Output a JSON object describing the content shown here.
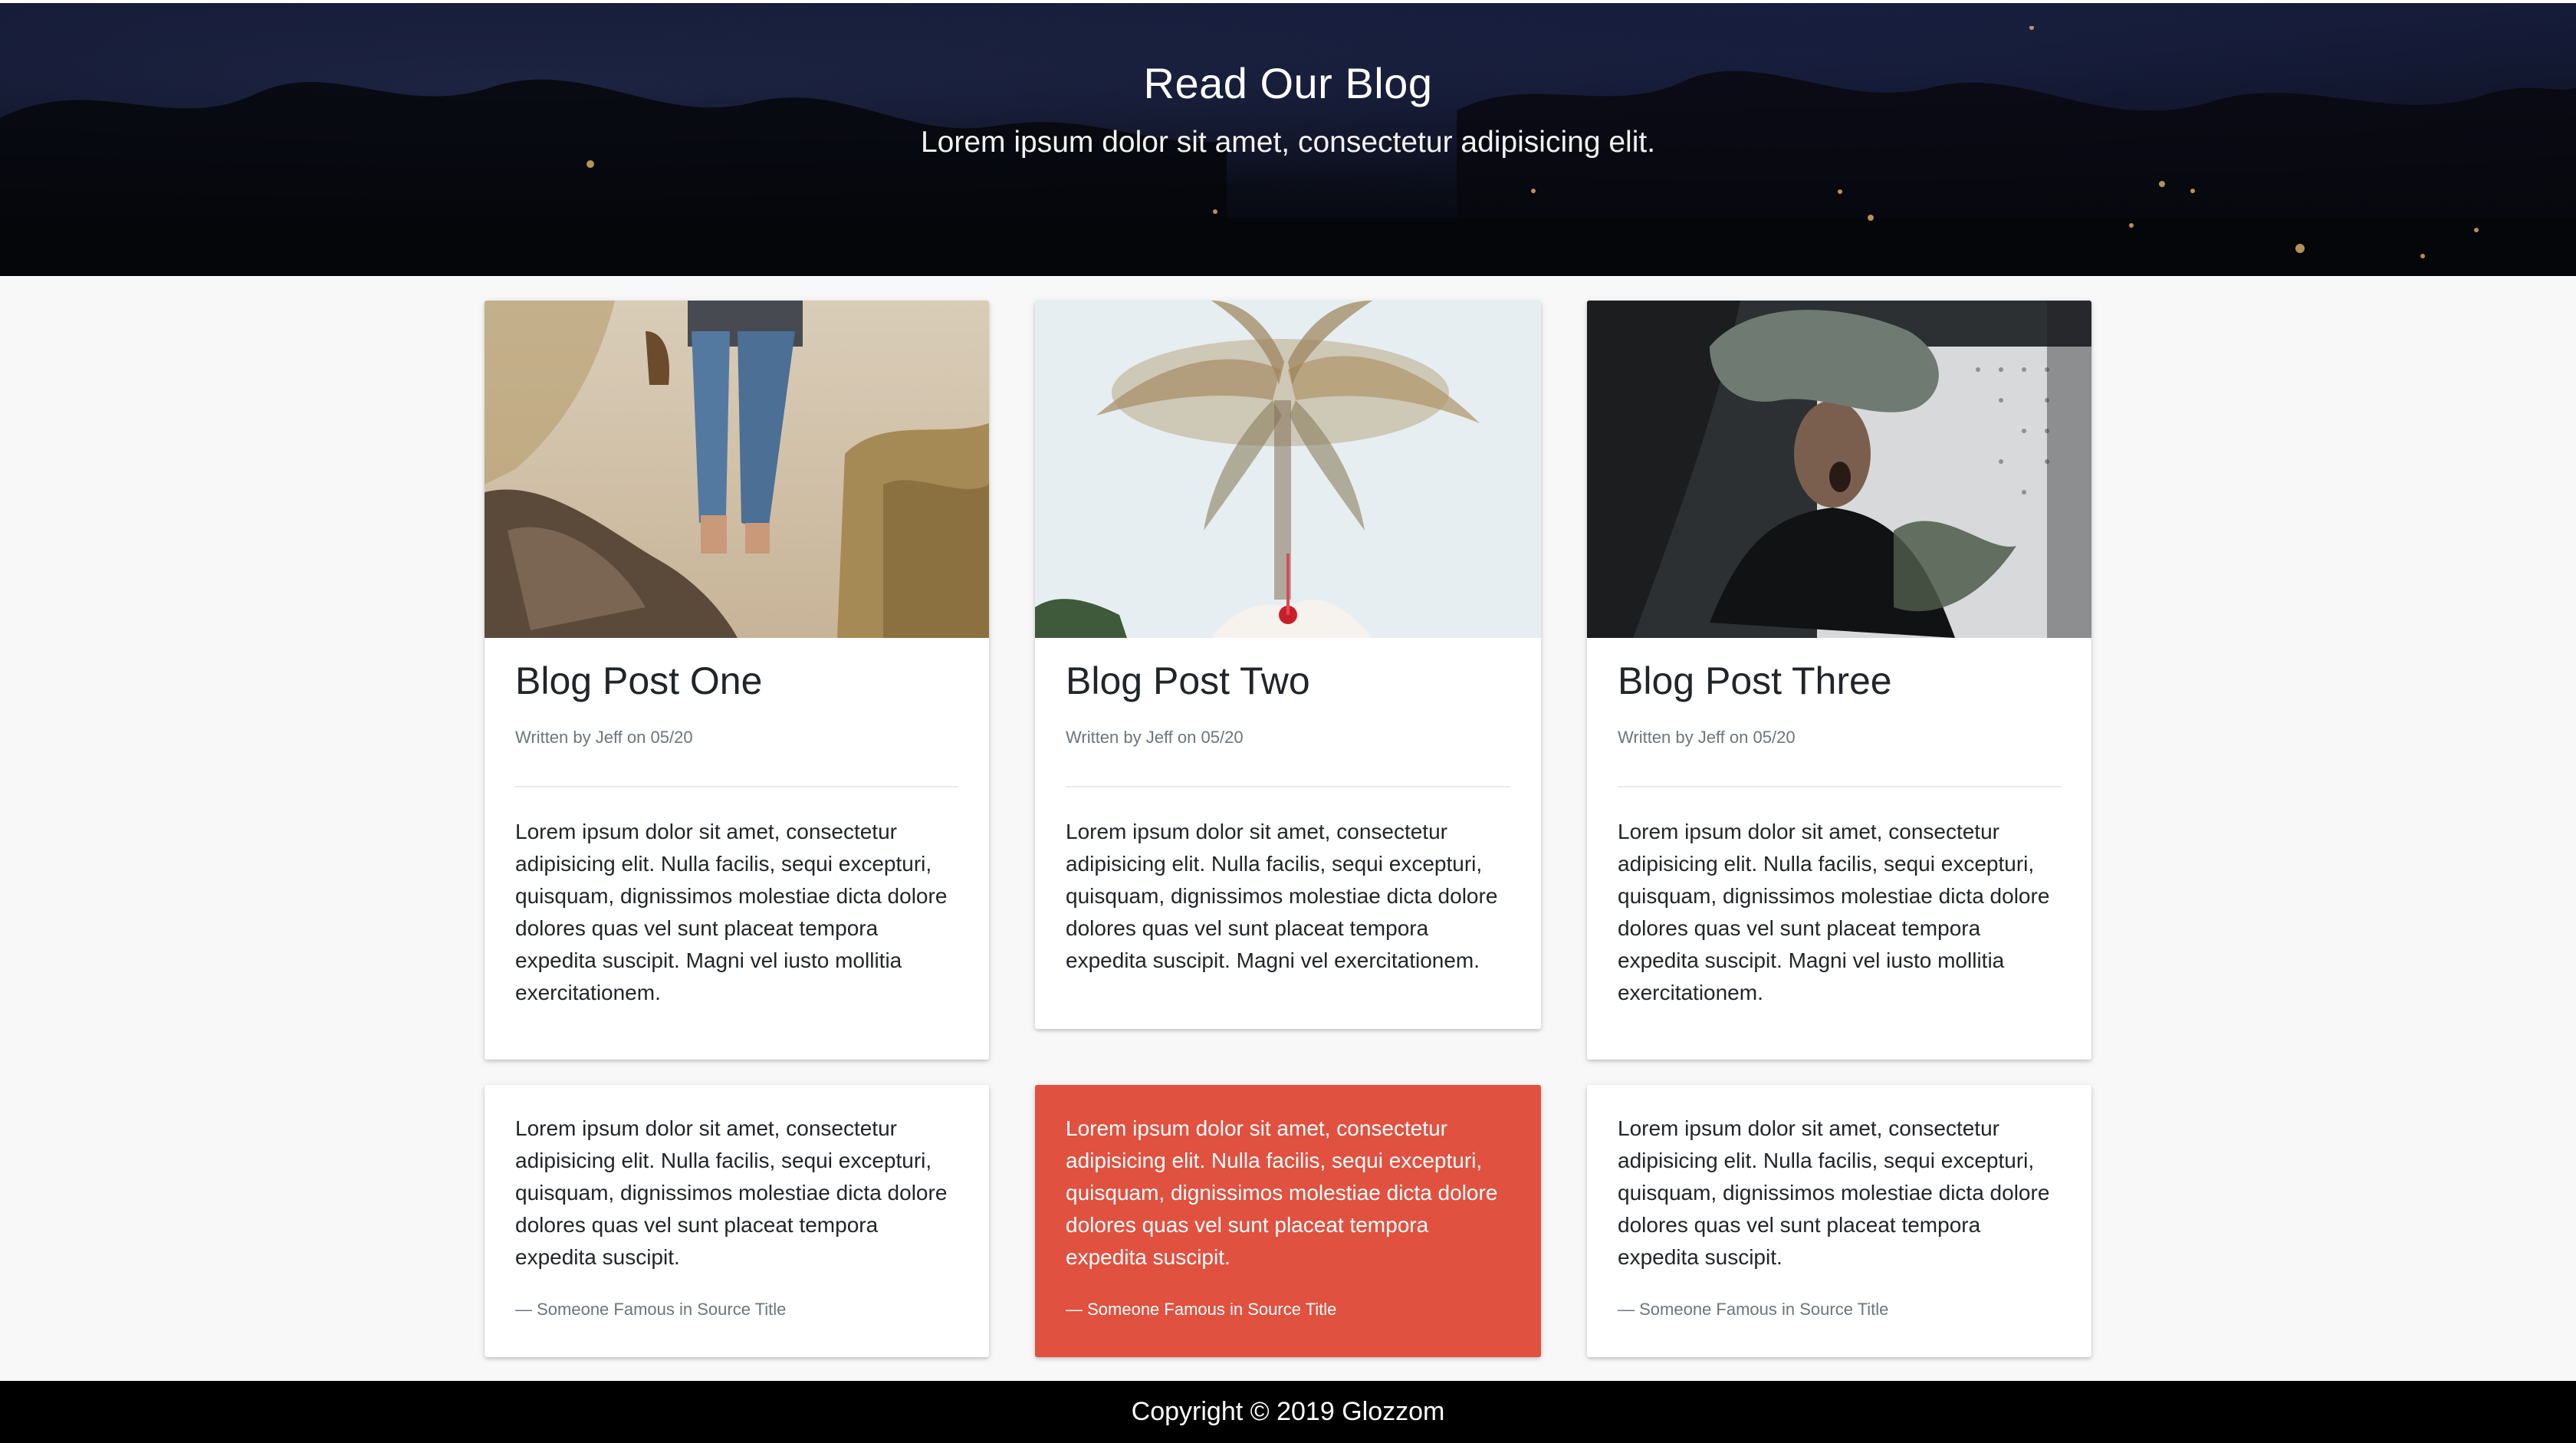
{
  "hero": {
    "title": "Read Our Blog",
    "subtitle": "Lorem ipsum dolor sit amet, consectetur adipisicing elit."
  },
  "posts": [
    {
      "image": "beach-walker-photo",
      "title": "Blog Post One",
      "meta": "Written by Jeff on 05/20",
      "body": "Lorem ipsum dolor sit amet, consectetur adipisicing elit. Nulla facilis, sequi excepturi, quisquam, dignissimos molestiae dicta dolore dolores quas vel sunt placeat tempora expedita suscipit. Magni vel iusto mollitia exercitationem."
    },
    {
      "image": "palm-tree-photo",
      "title": "Blog Post Two",
      "meta": "Written by Jeff on 05/20",
      "body": "Lorem ipsum dolor sit amet, consectetur adipisicing elit. Nulla facilis, sequi excepturi, quisquam, dignissimos molestiae dicta dolore dolores quas vel sunt placeat tempora expedita suscipit. Magni vel exercitationem."
    },
    {
      "image": "masked-person-photo",
      "title": "Blog Post Three",
      "meta": "Written by Jeff on 05/20",
      "body": "Lorem ipsum dolor sit amet, consectetur adipisicing elit. Nulla facilis, sequi excepturi, quisquam, dignissimos molestiae dicta dolore dolores quas vel sunt placeat tempora expedita suscipit. Magni vel iusto mollitia exercitationem."
    }
  ],
  "quotes": [
    {
      "text": "Lorem ipsum dolor sit amet, consectetur adipisicing elit. Nulla facilis, sequi excepturi, quisquam, dignissimos molestiae dicta dolore dolores quas vel sunt placeat tempora expedita suscipit.",
      "source": "— Someone Famous in Source Title"
    },
    {
      "text": "Lorem ipsum dolor sit amet, consectetur adipisicing elit. Nulla facilis, sequi excepturi, quisquam, dignissimos molestiae dicta dolore dolores quas vel sunt placeat tempora expedita suscipit.",
      "source": "— Someone Famous in Source Title"
    },
    {
      "text": "Lorem ipsum dolor sit amet, consectetur adipisicing elit. Nulla facilis, sequi excepturi, quisquam, dignissimos molestiae dicta dolore dolores quas vel sunt placeat tempora expedita suscipit.",
      "source": "— Someone Famous in Source Title"
    }
  ],
  "colors": {
    "accent": "#e05140",
    "footer_bg": "#000000",
    "page_bg": "#f8f8f8"
  },
  "footer": {
    "copyright": "Copyright © 2019 Glozzom"
  }
}
